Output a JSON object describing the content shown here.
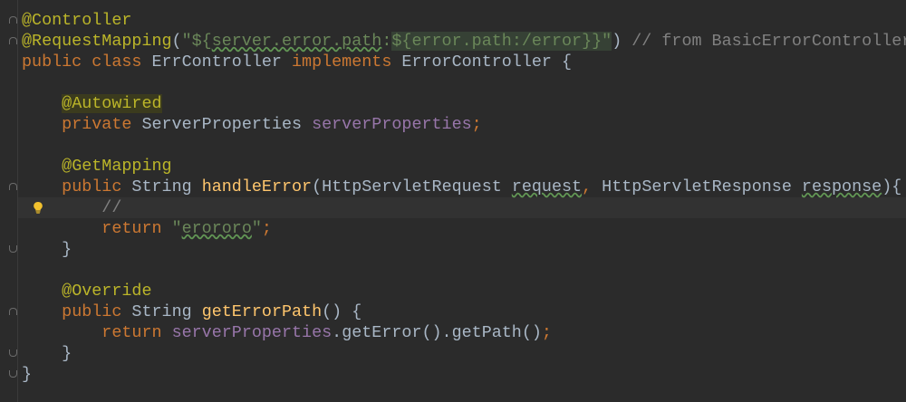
{
  "editor": {
    "language": "java",
    "active_line_index": 9,
    "lines": [
      [
        {
          "t": "@Controller",
          "c": "ann"
        }
      ],
      [
        {
          "t": "@RequestMapping",
          "c": "ann"
        },
        {
          "t": "(",
          "c": "plain"
        },
        {
          "t": "\"${",
          "c": "str"
        },
        {
          "t": "server.error.path",
          "c": "str squiggle"
        },
        {
          "t": ":",
          "c": "str"
        },
        {
          "t": "${",
          "c": "str inj"
        },
        {
          "t": "error.path:/error",
          "c": "str inj"
        },
        {
          "t": "}}\"",
          "c": "str inj"
        },
        {
          "t": ") ",
          "c": "plain"
        },
        {
          "t": "// from BasicErrorController",
          "c": "comment"
        }
      ],
      [
        {
          "t": "public class ",
          "c": "kw"
        },
        {
          "t": "ErrController ",
          "c": "plain"
        },
        {
          "t": "implements ",
          "c": "kw"
        },
        {
          "t": "ErrorController {",
          "c": "plain"
        }
      ],
      [
        {
          "t": "",
          "c": "plain"
        }
      ],
      [
        {
          "t": "    ",
          "c": "plain"
        },
        {
          "t": "@Autowired",
          "c": "ann ann-hl"
        }
      ],
      [
        {
          "t": "    ",
          "c": "plain"
        },
        {
          "t": "private ",
          "c": "kw"
        },
        {
          "t": "ServerProperties ",
          "c": "plain"
        },
        {
          "t": "serverProperties",
          "c": "field"
        },
        {
          "t": ";",
          "c": "kw"
        }
      ],
      [
        {
          "t": "",
          "c": "plain"
        }
      ],
      [
        {
          "t": "    ",
          "c": "plain"
        },
        {
          "t": "@GetMapping",
          "c": "ann"
        }
      ],
      [
        {
          "t": "    ",
          "c": "plain"
        },
        {
          "t": "public ",
          "c": "kw"
        },
        {
          "t": "String ",
          "c": "plain"
        },
        {
          "t": "handleError",
          "c": "method"
        },
        {
          "t": "(HttpServletRequest ",
          "c": "plain"
        },
        {
          "t": "request",
          "c": "plain squiggle"
        },
        {
          "t": ", ",
          "c": "kw"
        },
        {
          "t": "HttpServletResponse ",
          "c": "plain"
        },
        {
          "t": "response",
          "c": "plain squiggle"
        },
        {
          "t": "){",
          "c": "plain"
        }
      ],
      [
        {
          "t": "        ",
          "c": "plain"
        },
        {
          "t": "//",
          "c": "comment"
        }
      ],
      [
        {
          "t": "        ",
          "c": "plain"
        },
        {
          "t": "return ",
          "c": "kw"
        },
        {
          "t": "\"",
          "c": "str"
        },
        {
          "t": "erororo",
          "c": "str squiggle"
        },
        {
          "t": "\"",
          "c": "str"
        },
        {
          "t": ";",
          "c": "kw"
        }
      ],
      [
        {
          "t": "    }",
          "c": "plain"
        }
      ],
      [
        {
          "t": "",
          "c": "plain"
        }
      ],
      [
        {
          "t": "    ",
          "c": "plain"
        },
        {
          "t": "@Override",
          "c": "ann"
        }
      ],
      [
        {
          "t": "    ",
          "c": "plain"
        },
        {
          "t": "public ",
          "c": "kw"
        },
        {
          "t": "String ",
          "c": "plain"
        },
        {
          "t": "getErrorPath",
          "c": "method"
        },
        {
          "t": "() {",
          "c": "plain"
        }
      ],
      [
        {
          "t": "        ",
          "c": "plain"
        },
        {
          "t": "return ",
          "c": "kw"
        },
        {
          "t": "serverProperties",
          "c": "field"
        },
        {
          "t": ".getError().getPath()",
          "c": "plain"
        },
        {
          "t": ";",
          "c": "kw"
        }
      ],
      [
        {
          "t": "    }",
          "c": "plain"
        }
      ],
      [
        {
          "t": "}",
          "c": "plain"
        }
      ]
    ],
    "fold_markers": [
      {
        "line": 0,
        "dir": "up"
      },
      {
        "line": 1,
        "dir": "up"
      },
      {
        "line": 8,
        "dir": "up"
      },
      {
        "line": 11,
        "dir": "down"
      },
      {
        "line": 14,
        "dir": "up"
      },
      {
        "line": 16,
        "dir": "down"
      },
      {
        "line": 17,
        "dir": "down"
      }
    ],
    "intention_bulb_line": 9,
    "colors": {
      "background": "#2b2b2b",
      "keyword": "#cc7832",
      "annotation": "#bbb529",
      "string": "#6a8759",
      "field": "#9876aa",
      "method": "#ffc66d",
      "comment": "#808080",
      "text": "#a9b7c6",
      "bulb": "#f2c12e"
    }
  }
}
